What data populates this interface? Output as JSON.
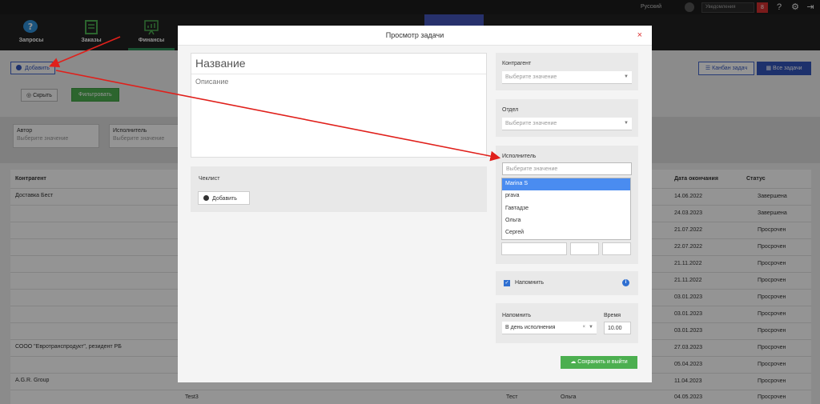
{
  "topbar": {
    "language": "Русский",
    "notifications_label": "Уведомления",
    "notifications_count": "8"
  },
  "nav": {
    "items": [
      {
        "label": "Запросы"
      },
      {
        "label": "Заказы"
      },
      {
        "label": "Финансы"
      }
    ]
  },
  "toolbar": {
    "add_label": "Добавить",
    "hide_label": "Скрыть",
    "filter_label": "Фильтровать",
    "kanban_label": "Канбан задач",
    "all_tasks_label": "Все задачи"
  },
  "filters": [
    {
      "label": "Автор",
      "placeholder": "Выберите значение"
    },
    {
      "label": "Исполнитель",
      "placeholder": "Выберите значение"
    }
  ],
  "table": {
    "headers": {
      "contractor": "Контрагент",
      "end_date": "Дата окончания",
      "status": "Статус"
    },
    "rows": [
      {
        "contractor": "Доставка Бест",
        "end_date": "14.06.2022",
        "status": "Завершена"
      },
      {
        "contractor": "",
        "end_date": "24.03.2023",
        "status": "Завершена"
      },
      {
        "contractor": "",
        "end_date": "21.07.2022",
        "status": "Просрочен"
      },
      {
        "contractor": "",
        "end_date": "22.07.2022",
        "status": "Просрочен"
      },
      {
        "contractor": "",
        "end_date": "21.11.2022",
        "status": "Просрочен"
      },
      {
        "contractor": "",
        "end_date": "21.11.2022",
        "status": "Просрочен"
      },
      {
        "contractor": "",
        "end_date": "03.01.2023",
        "status": "Просрочен"
      },
      {
        "contractor": "",
        "end_date": "03.01.2023",
        "status": "Просрочен"
      },
      {
        "contractor": "",
        "end_date": "03.01.2023",
        "status": "Просрочен"
      },
      {
        "contractor": "СООО \"Евротранспродукт\", резидент РБ",
        "end_date": "27.03.2023",
        "status": "Просрочен"
      },
      {
        "contractor": "",
        "end_date": "05.04.2023",
        "status": "Просрочен"
      },
      {
        "contractor": "A.G.R. Group",
        "end_date": "11.04.2023",
        "status": "Просрочен"
      },
      {
        "contractor": "",
        "end_date": "04.05.2023",
        "status": "Просрочен"
      }
    ],
    "last_row_extra": {
      "name": "Test3",
      "col_a": "Тест",
      "col_b": "Ольга"
    }
  },
  "modal": {
    "title": "Просмотр задачи",
    "close": "×",
    "name_placeholder": "Название",
    "description_placeholder": "Описание",
    "checklist_label": "Чеклист",
    "checklist_add": "Добавить",
    "contractor_label": "Контрагент",
    "contractor_placeholder": "Выберите значение",
    "department_label": "Отдел",
    "department_placeholder": "Выберите значение",
    "executor_label": "Исполнитель",
    "executor_placeholder": "Выберите значение",
    "executor_options": [
      "Marina S",
      "prava",
      "Гавтадзе",
      "Ольга",
      "Сергей"
    ],
    "remind_label": "Напомнить",
    "remind_checked": true,
    "remind_when_label": "Напомнить",
    "remind_when_value": "В день исполнения",
    "time_label": "Время",
    "time_value": "10.00",
    "save_label": "Сохранить и выйти"
  },
  "colors": {
    "accent_green": "#4caf50",
    "accent_blue": "#3355bb",
    "close_red": "#dd3333",
    "arrow_red": "#e0201b"
  }
}
